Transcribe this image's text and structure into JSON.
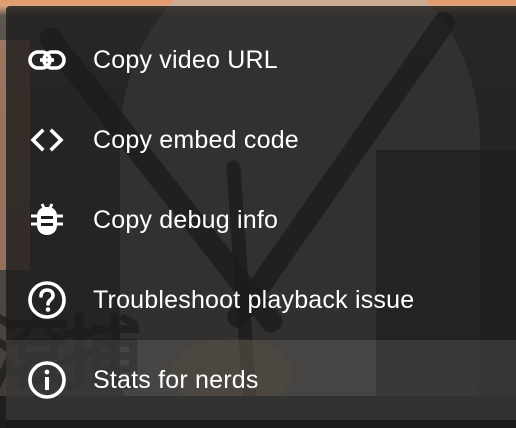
{
  "menu": {
    "items": [
      {
        "label": "Copy video URL",
        "icon": "link-icon"
      },
      {
        "label": "Copy embed code",
        "icon": "code-brackets-icon"
      },
      {
        "label": "Copy debug info",
        "icon": "bug-icon"
      },
      {
        "label": "Troubleshoot playback issue",
        "icon": "question-circle-icon"
      },
      {
        "label": "Stats for nerds",
        "icon": "info-circle-icon"
      }
    ]
  },
  "colors": {
    "menu_background": "#1c1c1c",
    "text": "#ffffff",
    "icon": "#ffffff"
  }
}
